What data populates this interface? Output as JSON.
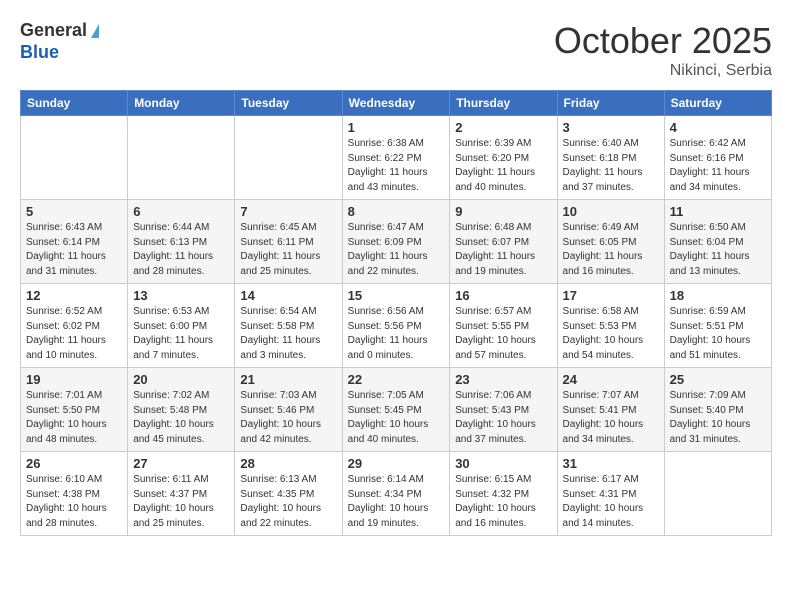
{
  "header": {
    "logo_general": "General",
    "logo_blue": "Blue",
    "month_title": "October 2025",
    "location": "Nikinci, Serbia"
  },
  "days_of_week": [
    "Sunday",
    "Monday",
    "Tuesday",
    "Wednesday",
    "Thursday",
    "Friday",
    "Saturday"
  ],
  "weeks": [
    [
      {
        "day": "",
        "info": ""
      },
      {
        "day": "",
        "info": ""
      },
      {
        "day": "",
        "info": ""
      },
      {
        "day": "1",
        "info": "Sunrise: 6:38 AM\nSunset: 6:22 PM\nDaylight: 11 hours\nand 43 minutes."
      },
      {
        "day": "2",
        "info": "Sunrise: 6:39 AM\nSunset: 6:20 PM\nDaylight: 11 hours\nand 40 minutes."
      },
      {
        "day": "3",
        "info": "Sunrise: 6:40 AM\nSunset: 6:18 PM\nDaylight: 11 hours\nand 37 minutes."
      },
      {
        "day": "4",
        "info": "Sunrise: 6:42 AM\nSunset: 6:16 PM\nDaylight: 11 hours\nand 34 minutes."
      }
    ],
    [
      {
        "day": "5",
        "info": "Sunrise: 6:43 AM\nSunset: 6:14 PM\nDaylight: 11 hours\nand 31 minutes."
      },
      {
        "day": "6",
        "info": "Sunrise: 6:44 AM\nSunset: 6:13 PM\nDaylight: 11 hours\nand 28 minutes."
      },
      {
        "day": "7",
        "info": "Sunrise: 6:45 AM\nSunset: 6:11 PM\nDaylight: 11 hours\nand 25 minutes."
      },
      {
        "day": "8",
        "info": "Sunrise: 6:47 AM\nSunset: 6:09 PM\nDaylight: 11 hours\nand 22 minutes."
      },
      {
        "day": "9",
        "info": "Sunrise: 6:48 AM\nSunset: 6:07 PM\nDaylight: 11 hours\nand 19 minutes."
      },
      {
        "day": "10",
        "info": "Sunrise: 6:49 AM\nSunset: 6:05 PM\nDaylight: 11 hours\nand 16 minutes."
      },
      {
        "day": "11",
        "info": "Sunrise: 6:50 AM\nSunset: 6:04 PM\nDaylight: 11 hours\nand 13 minutes."
      }
    ],
    [
      {
        "day": "12",
        "info": "Sunrise: 6:52 AM\nSunset: 6:02 PM\nDaylight: 11 hours\nand 10 minutes."
      },
      {
        "day": "13",
        "info": "Sunrise: 6:53 AM\nSunset: 6:00 PM\nDaylight: 11 hours\nand 7 minutes."
      },
      {
        "day": "14",
        "info": "Sunrise: 6:54 AM\nSunset: 5:58 PM\nDaylight: 11 hours\nand 3 minutes."
      },
      {
        "day": "15",
        "info": "Sunrise: 6:56 AM\nSunset: 5:56 PM\nDaylight: 11 hours\nand 0 minutes."
      },
      {
        "day": "16",
        "info": "Sunrise: 6:57 AM\nSunset: 5:55 PM\nDaylight: 10 hours\nand 57 minutes."
      },
      {
        "day": "17",
        "info": "Sunrise: 6:58 AM\nSunset: 5:53 PM\nDaylight: 10 hours\nand 54 minutes."
      },
      {
        "day": "18",
        "info": "Sunrise: 6:59 AM\nSunset: 5:51 PM\nDaylight: 10 hours\nand 51 minutes."
      }
    ],
    [
      {
        "day": "19",
        "info": "Sunrise: 7:01 AM\nSunset: 5:50 PM\nDaylight: 10 hours\nand 48 minutes."
      },
      {
        "day": "20",
        "info": "Sunrise: 7:02 AM\nSunset: 5:48 PM\nDaylight: 10 hours\nand 45 minutes."
      },
      {
        "day": "21",
        "info": "Sunrise: 7:03 AM\nSunset: 5:46 PM\nDaylight: 10 hours\nand 42 minutes."
      },
      {
        "day": "22",
        "info": "Sunrise: 7:05 AM\nSunset: 5:45 PM\nDaylight: 10 hours\nand 40 minutes."
      },
      {
        "day": "23",
        "info": "Sunrise: 7:06 AM\nSunset: 5:43 PM\nDaylight: 10 hours\nand 37 minutes."
      },
      {
        "day": "24",
        "info": "Sunrise: 7:07 AM\nSunset: 5:41 PM\nDaylight: 10 hours\nand 34 minutes."
      },
      {
        "day": "25",
        "info": "Sunrise: 7:09 AM\nSunset: 5:40 PM\nDaylight: 10 hours\nand 31 minutes."
      }
    ],
    [
      {
        "day": "26",
        "info": "Sunrise: 6:10 AM\nSunset: 4:38 PM\nDaylight: 10 hours\nand 28 minutes."
      },
      {
        "day": "27",
        "info": "Sunrise: 6:11 AM\nSunset: 4:37 PM\nDaylight: 10 hours\nand 25 minutes."
      },
      {
        "day": "28",
        "info": "Sunrise: 6:13 AM\nSunset: 4:35 PM\nDaylight: 10 hours\nand 22 minutes."
      },
      {
        "day": "29",
        "info": "Sunrise: 6:14 AM\nSunset: 4:34 PM\nDaylight: 10 hours\nand 19 minutes."
      },
      {
        "day": "30",
        "info": "Sunrise: 6:15 AM\nSunset: 4:32 PM\nDaylight: 10 hours\nand 16 minutes."
      },
      {
        "day": "31",
        "info": "Sunrise: 6:17 AM\nSunset: 4:31 PM\nDaylight: 10 hours\nand 14 minutes."
      },
      {
        "day": "",
        "info": ""
      }
    ]
  ]
}
